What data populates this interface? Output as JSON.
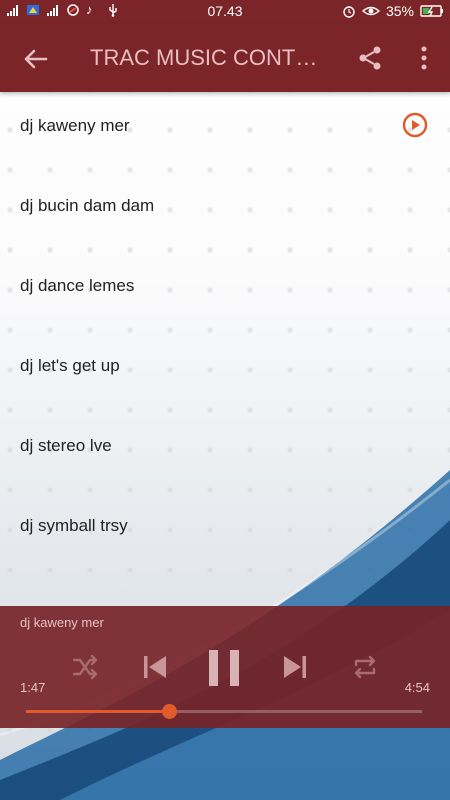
{
  "status_bar": {
    "time": "07.43",
    "battery": "35%"
  },
  "app_bar": {
    "title": "TRAC MUSIC CONT…"
  },
  "tracks": [
    {
      "label": "dj kaweny mer",
      "playing": true
    },
    {
      "label": "dj bucin dam dam",
      "playing": false
    },
    {
      "label": "dj dance lemes",
      "playing": false
    },
    {
      "label": "dj let's get up",
      "playing": false
    },
    {
      "label": "dj stereo lve",
      "playing": false
    },
    {
      "label": "dj symball trsy",
      "playing": false
    }
  ],
  "player": {
    "now_playing": "dj kaweny mer",
    "elapsed": "1:47",
    "duration": "4:54",
    "progress": 0.36
  },
  "colors": {
    "primary": "#7b2528",
    "accent": "#e05a2b"
  }
}
